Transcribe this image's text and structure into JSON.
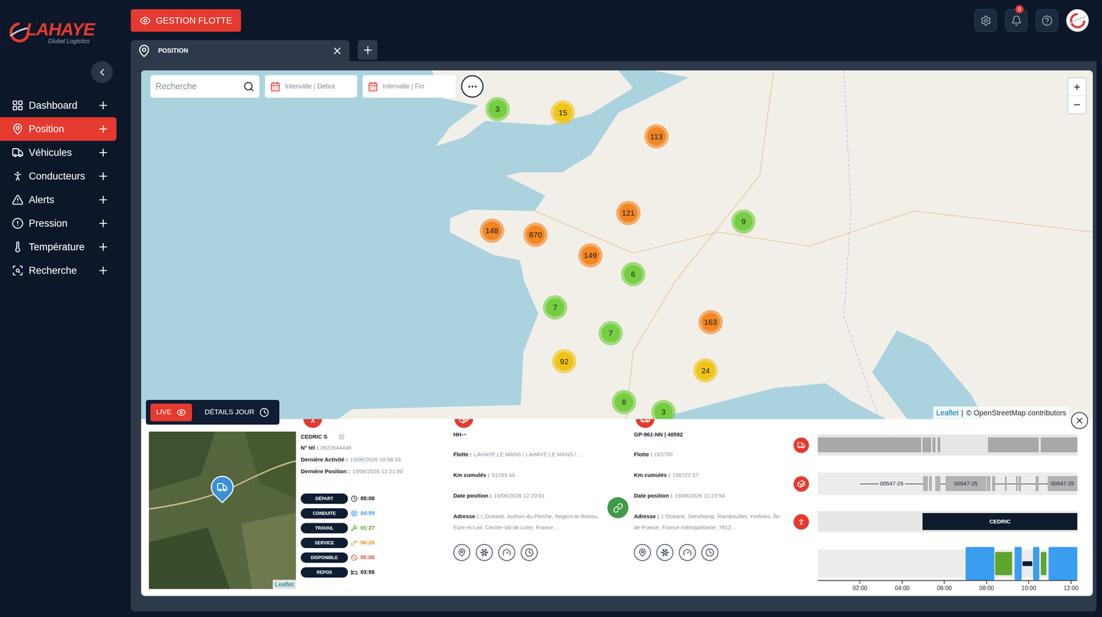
{
  "brand": {
    "name": "LAHAYE",
    "tagline": "Global Logistics"
  },
  "header": {
    "mode_button": "GESTION FLOTTE",
    "notification_count": "0"
  },
  "tabs": [
    {
      "label": "POSITION",
      "selected": true
    }
  ],
  "sidebar": {
    "items": [
      {
        "label": "Dashboard",
        "kind": "dashboard",
        "selected": false
      },
      {
        "label": "Position",
        "kind": "position",
        "selected": true
      },
      {
        "label": "Véhicules",
        "kind": "vehicules",
        "selected": false
      },
      {
        "label": "Conducteurs",
        "kind": "conducteurs",
        "selected": false
      },
      {
        "label": "Alerts",
        "kind": "alerts",
        "selected": false
      },
      {
        "label": "Pression",
        "kind": "pression",
        "selected": false
      },
      {
        "label": "Température",
        "kind": "temperature",
        "selected": false
      },
      {
        "label": "Recherche",
        "kind": "recherche",
        "selected": false
      }
    ]
  },
  "map": {
    "search": {
      "placeholder": "Recherche"
    },
    "date_start": {
      "placeholder": "Intervalle | Début"
    },
    "date_end": {
      "placeholder": "Intervalle | Fin"
    },
    "zoom_in": "+",
    "zoom_out": "−",
    "attribution": {
      "library": "Leaflet",
      "separator": "|",
      "credit": "© OpenStreetMap contributors"
    },
    "clusters": [
      {
        "count": "3",
        "color": "#6ecc39"
      },
      {
        "count": "15",
        "color": "#f0c20c"
      },
      {
        "count": "113",
        "color": "#f18017"
      },
      {
        "count": "121",
        "color": "#f18017"
      },
      {
        "count": "9",
        "color": "#6ecc39"
      },
      {
        "count": "148",
        "color": "#f18017"
      },
      {
        "count": "870",
        "color": "#f18017"
      },
      {
        "count": "149",
        "color": "#f18017"
      },
      {
        "count": "6",
        "color": "#6ecc39"
      },
      {
        "count": "7",
        "color": "#6ecc39"
      },
      {
        "count": "163",
        "color": "#f18017"
      },
      {
        "count": "7",
        "color": "#6ecc39"
      },
      {
        "count": "92",
        "color": "#f0c20c"
      },
      {
        "count": "24",
        "color": "#f0c20c"
      },
      {
        "count": "8",
        "color": "#6ecc39"
      },
      {
        "count": "3",
        "color": "#6ecc39"
      }
    ]
  },
  "view_modes": [
    {
      "label": "LIVE",
      "selected": true
    },
    {
      "label": "DÉTAILS JOUR",
      "selected": false
    }
  ],
  "minimap": {
    "attribution": "Leaflet"
  },
  "driver": {
    "name": "CEDRIC S",
    "fields": [
      {
        "label": "N° tél :",
        "value": "0622644448"
      },
      {
        "label": "Dernière Activité :",
        "value": "19/06/2026 10:58:33"
      },
      {
        "label": "Dernière Position :",
        "value": "19/06/2026 12:21:00"
      }
    ],
    "statuses": [
      {
        "label": "DÉPART",
        "kind": "depart",
        "time": "05:00",
        "color": "#111111"
      },
      {
        "label": "CONDUITE",
        "kind": "conduite",
        "time": "04:59",
        "color": "#3a9ee8"
      },
      {
        "label": "TRAVAIL",
        "kind": "travail",
        "time": "01:27",
        "color": "#5a9e2c"
      },
      {
        "label": "SERVICE",
        "kind": "service",
        "time": "06:26",
        "color": "#e8961e"
      },
      {
        "label": "DISPONIBLE",
        "kind": "disponible",
        "time": "00:00",
        "color": "#e0483a"
      },
      {
        "label": "REPOS",
        "kind": "repos",
        "time": "03:55",
        "color": "#111111"
      }
    ]
  },
  "trailer": {
    "title": "HH-~",
    "fields": [
      {
        "label": "Flotte :",
        "value": "LAHAYE LE MANS / LAHAYE LE MANS /…"
      },
      {
        "label": "Km cumulés :",
        "value": "51293.44"
      },
      {
        "label": "Date position :",
        "value": "19/06/2026 12:20:01"
      },
      {
        "label": "Adresse :",
        "value": "L'Océane, Authon-du-Perche, Nogent-le-Rotrou, Eure-et-Loir, Centre-Val de Loire, France…"
      }
    ]
  },
  "link": {
    "linked": true
  },
  "truck": {
    "title": "GP-961-NN | 40592",
    "fields": [
      {
        "label": "Flotte :",
        "value": "DISTRI"
      },
      {
        "label": "Km cumulés :",
        "value": "100722.57"
      },
      {
        "label": "Date position :",
        "value": "19/06/2026 11:23:54"
      },
      {
        "label": "Adresse :",
        "value": "L'Océane, Sonchamp, Rambouillet, Yvelines, Île-de-France, France métropolitaine, 7812…"
      }
    ]
  },
  "timeline": {
    "axis": {
      "min": 0,
      "max": 12.3,
      "ticks": [
        {
          "label": "02:00",
          "value": 2
        },
        {
          "label": "04:00",
          "value": 4
        },
        {
          "label": "06:00",
          "value": 6
        },
        {
          "label": "08:00",
          "value": 8
        },
        {
          "label": "10:00",
          "value": 10
        },
        {
          "label": "12:00",
          "value": 12
        }
      ]
    },
    "truck_segments": [
      {
        "start": 0,
        "end": 4.9
      },
      {
        "start": 4.97,
        "end": 5.37
      },
      {
        "start": 5.43,
        "end": 5.57
      },
      {
        "start": 5.67,
        "end": 5.8
      },
      {
        "start": 8.07,
        "end": 10.47
      },
      {
        "start": 10.57,
        "end": 12.3
      }
    ],
    "trailer_segments": [
      {
        "start": 2.0,
        "end": 5.0,
        "kind": "line",
        "label": "00547-25"
      },
      {
        "start": 5.0,
        "end": 5.2,
        "kind": "bar"
      },
      {
        "start": 5.27,
        "end": 5.4,
        "kind": "bar"
      },
      {
        "start": 5.57,
        "end": 5.8,
        "kind": "bar"
      },
      {
        "start": 5.8,
        "end": 6.07,
        "kind": "line"
      },
      {
        "start": 6.07,
        "end": 7.97,
        "kind": "bar",
        "label": "00547-25"
      },
      {
        "start": 8.0,
        "end": 8.17,
        "kind": "bar"
      },
      {
        "start": 8.27,
        "end": 8.4,
        "kind": "bar"
      },
      {
        "start": 8.4,
        "end": 10.9,
        "kind": "line"
      },
      {
        "start": 8.87,
        "end": 8.95,
        "kind": "bar"
      },
      {
        "start": 9.4,
        "end": 9.47,
        "kind": "bar"
      },
      {
        "start": 9.53,
        "end": 9.63,
        "kind": "bar"
      },
      {
        "start": 10.33,
        "end": 10.47,
        "kind": "bar"
      },
      {
        "start": 10.9,
        "end": 12.3,
        "kind": "bar",
        "label": "00547-25"
      }
    ],
    "driver_bar": {
      "start": 4.97,
      "end": 12.3,
      "label": "CEDRIC"
    },
    "activity": [
      {
        "start": 7.0,
        "end": 8.37,
        "level": 1,
        "color": "#3a9ef0"
      },
      {
        "start": 8.4,
        "end": 9.2,
        "level": 0.7,
        "color": "#5fa52c"
      },
      {
        "start": 9.33,
        "end": 9.67,
        "level": 1,
        "color": "#3a9ef0"
      },
      {
        "start": 9.7,
        "end": 10.17,
        "level": 0.14,
        "color": "#0f1d33"
      },
      {
        "start": 10.2,
        "end": 10.5,
        "level": 1,
        "color": "#3a9ef0"
      },
      {
        "start": 10.57,
        "end": 10.83,
        "level": 0.7,
        "color": "#5fa52c"
      },
      {
        "start": 10.93,
        "end": 12.3,
        "level": 1,
        "color": "#3a9ef0"
      }
    ]
  }
}
